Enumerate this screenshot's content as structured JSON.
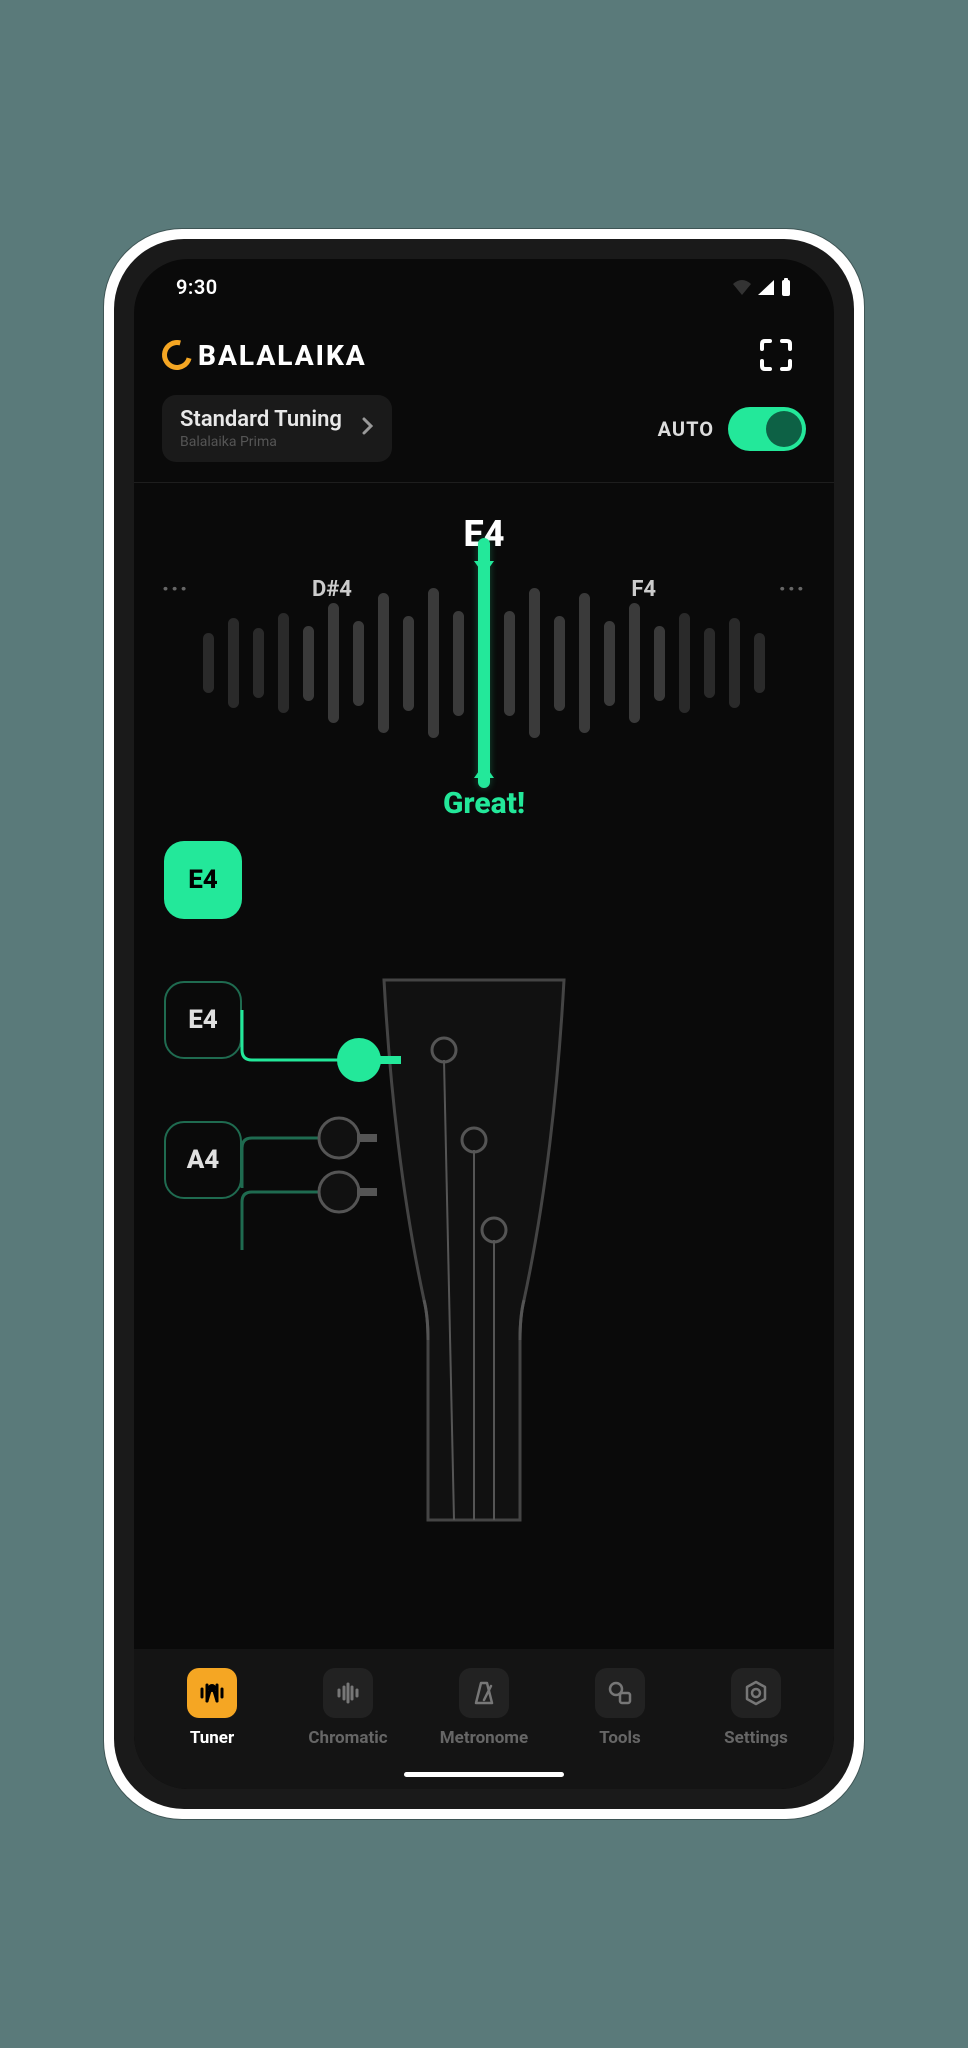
{
  "status_bar": {
    "time": "9:30"
  },
  "header": {
    "app_name": "BALALAIKA"
  },
  "tuning": {
    "name": "Standard Tuning",
    "subtitle": "Balalaika Prima",
    "auto_label": "AUTO",
    "auto_on": true
  },
  "meter": {
    "target_note": "E4",
    "left_note": "D#4",
    "right_note": "F4",
    "status": "Great!"
  },
  "strings": [
    {
      "label": "E4",
      "active": true
    },
    {
      "label": "E4",
      "active": false
    },
    {
      "label": "A4",
      "active": false
    }
  ],
  "nav": {
    "tuner": "Tuner",
    "chromatic": "Chromatic",
    "metronome": "Metronome",
    "tools": "Tools",
    "settings": "Settings"
  },
  "colors": {
    "accent": "#23e89a",
    "brand": "#f5a623"
  }
}
